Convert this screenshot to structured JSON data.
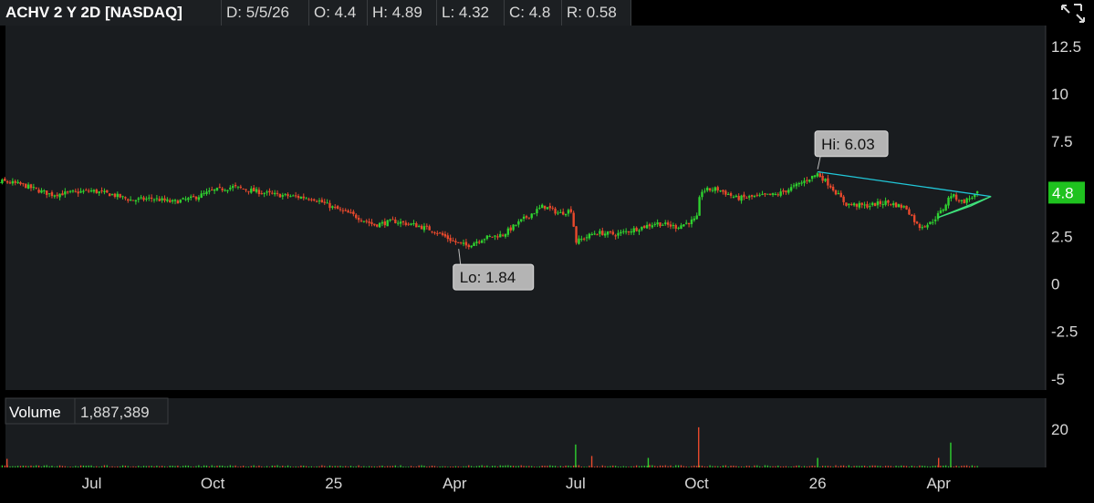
{
  "header": {
    "title": "ACHV 2 Y 2D [NASDAQ]",
    "fields": [
      "D: 5/5/26",
      "O: 4.4",
      "H: 4.89",
      "L: 4.32",
      "C: 4.8",
      "R: 0.58"
    ],
    "icon": "expand-collapse-icon"
  },
  "colors": {
    "up": "#2fd12f",
    "down": "#e8492c",
    "trend": "#21c7d8",
    "triangle": "#3ee07a",
    "price_tag": "#1fc21f",
    "bg": "#191c1f"
  },
  "chart_data": [
    {
      "type": "candlestick",
      "title": "ACHV 2 Y 2D [NASDAQ]",
      "ylim": [
        -6,
        14
      ],
      "yticks": [
        12.5,
        10,
        7.5,
        5,
        2.5,
        0,
        -2.5,
        -5
      ],
      "ytick_labels": [
        "12.5",
        "10",
        "7.5",
        "",
        "2.5",
        "0",
        "-2.5",
        "-5"
      ],
      "xticks": [
        {
          "label": "Jul",
          "month": 1.0
        },
        {
          "label": "Oct",
          "month": 4.0
        },
        {
          "label": "25",
          "month": 7.0
        },
        {
          "label": "Apr",
          "month": 10.0
        },
        {
          "label": "Jul",
          "month": 13.0
        },
        {
          "label": "Oct",
          "month": 16.0
        },
        {
          "label": "26",
          "month": 19.0
        },
        {
          "label": "Apr",
          "month": 22.0
        }
      ],
      "close_path": [
        [
          -2.0,
          4.6
        ],
        [
          -1.6,
          5.1
        ],
        [
          -1.2,
          5.4
        ],
        [
          -0.7,
          5.2
        ],
        [
          -0.3,
          4.9
        ],
        [
          0.0,
          4.7
        ],
        [
          0.5,
          4.8
        ],
        [
          1.0,
          4.9
        ],
        [
          1.5,
          4.7
        ],
        [
          2.0,
          4.4
        ],
        [
          2.5,
          4.5
        ],
        [
          3.0,
          4.3
        ],
        [
          3.5,
          4.5
        ],
        [
          4.0,
          4.9
        ],
        [
          4.5,
          5.1
        ],
        [
          5.0,
          4.9
        ],
        [
          5.5,
          4.7
        ],
        [
          6.0,
          4.6
        ],
        [
          6.5,
          4.5
        ],
        [
          7.0,
          4.0
        ],
        [
          7.5,
          3.6
        ],
        [
          8.0,
          3.1
        ],
        [
          8.5,
          3.3
        ],
        [
          9.0,
          3.1
        ],
        [
          9.5,
          2.8
        ],
        [
          10.0,
          2.2
        ],
        [
          10.3,
          2.0
        ],
        [
          10.7,
          2.4
        ],
        [
          11.2,
          2.6
        ],
        [
          11.7,
          3.4
        ],
        [
          12.2,
          4.1
        ],
        [
          12.6,
          3.7
        ],
        [
          12.9,
          3.9
        ],
        [
          13.0,
          2.2
        ],
        [
          13.5,
          2.7
        ],
        [
          14.0,
          2.6
        ],
        [
          14.5,
          2.9
        ],
        [
          15.0,
          3.2
        ],
        [
          15.5,
          3.0
        ],
        [
          16.0,
          3.4
        ],
        [
          16.1,
          4.9
        ],
        [
          16.5,
          5.0
        ],
        [
          17.0,
          4.5
        ],
        [
          17.5,
          4.6
        ],
        [
          18.0,
          4.7
        ],
        [
          18.5,
          5.2
        ],
        [
          19.0,
          5.8
        ],
        [
          19.3,
          5.2
        ],
        [
          19.7,
          4.2
        ],
        [
          20.2,
          4.1
        ],
        [
          20.7,
          4.3
        ],
        [
          21.2,
          4.0
        ],
        [
          21.5,
          3.0
        ],
        [
          21.8,
          3.2
        ],
        [
          22.1,
          3.9
        ],
        [
          22.3,
          4.7
        ],
        [
          22.6,
          4.3
        ],
        [
          23.0,
          4.8
        ]
      ],
      "annotations": [
        {
          "text": "Hi: 6.03",
          "month": 19.0,
          "value": 6.03
        },
        {
          "text": "Lo: 1.84",
          "month": 10.1,
          "value": 1.84
        }
      ],
      "trendline": [
        {
          "month": 19.0,
          "value": 5.9
        },
        {
          "month": 23.3,
          "value": 4.6
        }
      ],
      "triangle": [
        {
          "month": 22.0,
          "value": 3.5
        },
        {
          "month": 23.3,
          "value": 4.6
        },
        {
          "month": 22.8,
          "value": 4.1
        }
      ],
      "last_price": "4.8"
    },
    {
      "type": "bar",
      "title": "Volume",
      "current_label": "1,887,389",
      "ylim": [
        0,
        20
      ],
      "yticks": [
        20,
        0
      ],
      "ytick_labels": [
        "20",
        ""
      ],
      "spikes": [
        {
          "month": -1.1,
          "value": 4.5
        },
        {
          "month": 13.0,
          "value": 12
        },
        {
          "month": 13.4,
          "value": 6
        },
        {
          "month": 14.8,
          "value": 5
        },
        {
          "month": 16.05,
          "value": 21
        },
        {
          "month": 19.0,
          "value": 5
        },
        {
          "month": 22.0,
          "value": 5
        },
        {
          "month": 22.3,
          "value": 13
        }
      ]
    }
  ]
}
